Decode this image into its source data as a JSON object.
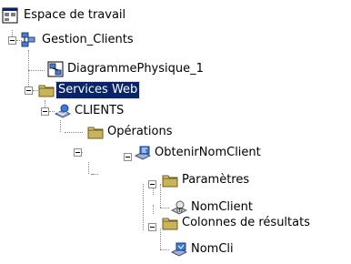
{
  "tree": {
    "workspace": "Espace de travail",
    "gestion_clients": "Gestion_Clients",
    "diagramme": "DiagrammePhysique_1",
    "services_web": "Services Web",
    "clients": "CLIENTS",
    "operations": "Opérations",
    "obtenir": "ObtenirNomClient",
    "parametres": "Paramètres",
    "param_nomclient": "NomClient",
    "colonnes": "Colonnes de résultats",
    "col_nomcli": "NomCli"
  },
  "icons": {
    "workspace": "workspace-icon",
    "model": "model-icon",
    "diagram": "diagram-icon",
    "folder": "folder-icon",
    "web-service": "web-service-icon",
    "operation": "operation-icon",
    "parameter": "parameter-icon",
    "result-column": "result-column-icon"
  },
  "colors": {
    "selection": "#0a246a",
    "folder": "#d9c77a",
    "tree_lines": "#8a8a8a"
  }
}
